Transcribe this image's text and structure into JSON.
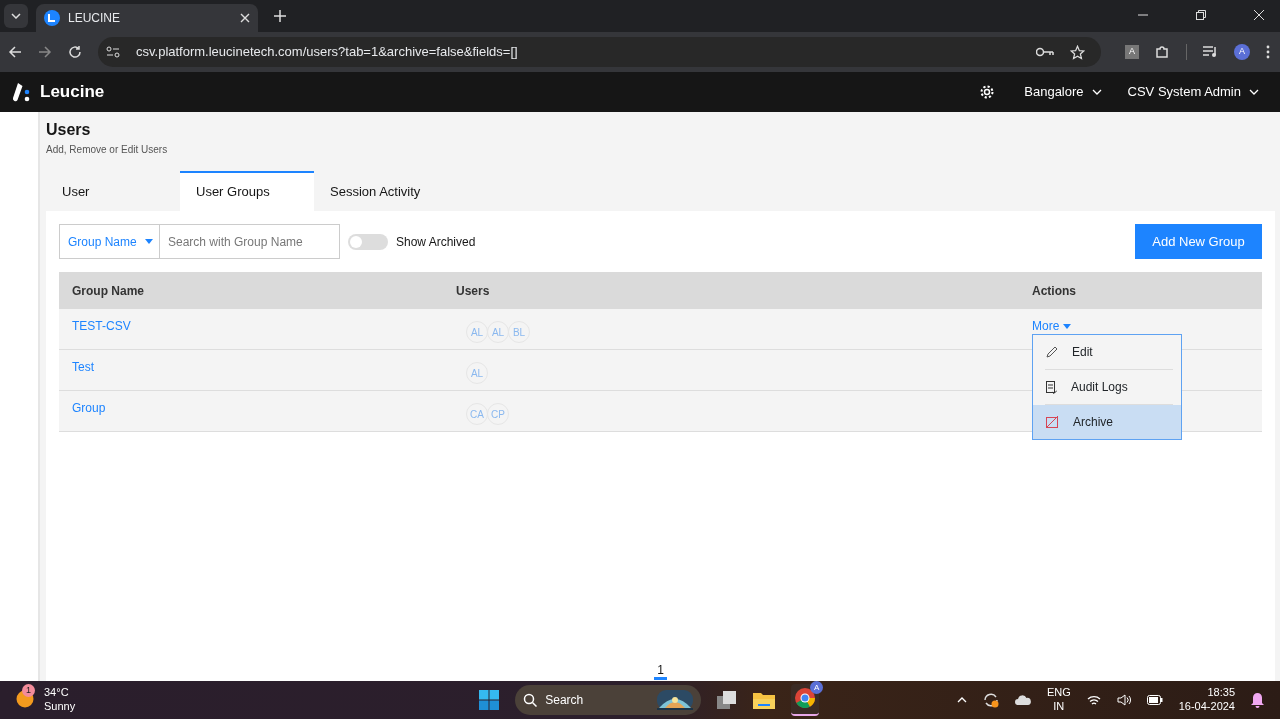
{
  "browser": {
    "tab_title": "LEUCINE",
    "url": "csv.platform.leucinetech.com/users?tab=1&archive=false&fields=[]",
    "translate_label": "A",
    "profile_initial": "A"
  },
  "header": {
    "brand": "Leucine",
    "location": "Bangalore",
    "user": "CSV System Admin"
  },
  "page": {
    "title": "Users",
    "subtitle": "Add, Remove or Edit Users"
  },
  "tabs": [
    {
      "label": "User",
      "selected": false
    },
    {
      "label": "User Groups",
      "selected": true
    },
    {
      "label": "Session Activity",
      "selected": false
    }
  ],
  "filter": {
    "field": "Group Name",
    "placeholder": "Search with Group Name",
    "toggle": {
      "label": "Show Archived",
      "on": false
    }
  },
  "add_button": "Add New Group",
  "table": {
    "columns": [
      "Group Name",
      "Users",
      "Actions"
    ],
    "rows": [
      {
        "name": "TEST-CSV",
        "users": [
          "AL",
          "AL",
          "BL"
        ],
        "action": "More"
      },
      {
        "name": "Test",
        "users": [
          "AL"
        ]
      },
      {
        "name": "Group",
        "users": [
          "CA",
          "CP"
        ]
      }
    ]
  },
  "action_menu": {
    "items": [
      {
        "label": "Edit",
        "kind": "edit",
        "selected": false
      },
      {
        "label": "Audit Logs",
        "kind": "audit",
        "selected": false
      },
      {
        "label": "Archive",
        "kind": "archive",
        "selected": true
      }
    ]
  },
  "pagination": [
    {
      "label": "1",
      "selected": true
    }
  ],
  "taskbar": {
    "weather_badge": "1",
    "temperature": "34°C",
    "condition": "Sunny",
    "search": "Search",
    "lang": "ENG",
    "region": "IN",
    "chrome_badge": "A",
    "time": "18:35",
    "date": "16-04-2024"
  }
}
